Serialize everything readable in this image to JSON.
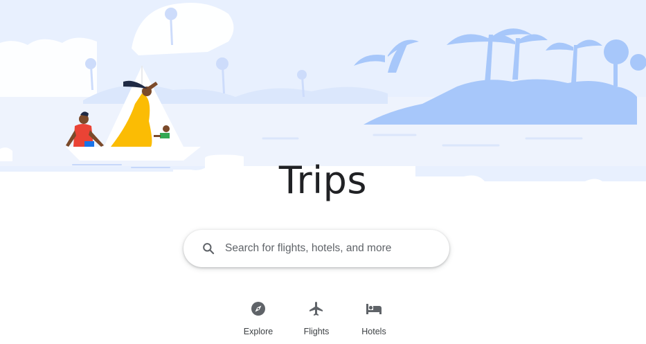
{
  "page": {
    "title": "Trips"
  },
  "search": {
    "placeholder": "Search for flights, hotels, and more",
    "icon": "search-icon"
  },
  "nav": {
    "items": [
      {
        "label": "Explore",
        "icon": "compass-icon"
      },
      {
        "label": "Flights",
        "icon": "airplane-icon"
      },
      {
        "label": "Hotels",
        "icon": "bed-icon"
      }
    ]
  },
  "colors": {
    "hero_sky": "#e8f0fe",
    "hero_shapes": "#d2e3fc",
    "island": "#a7c7fa",
    "title": "#202124",
    "icon": "#5f6368"
  }
}
